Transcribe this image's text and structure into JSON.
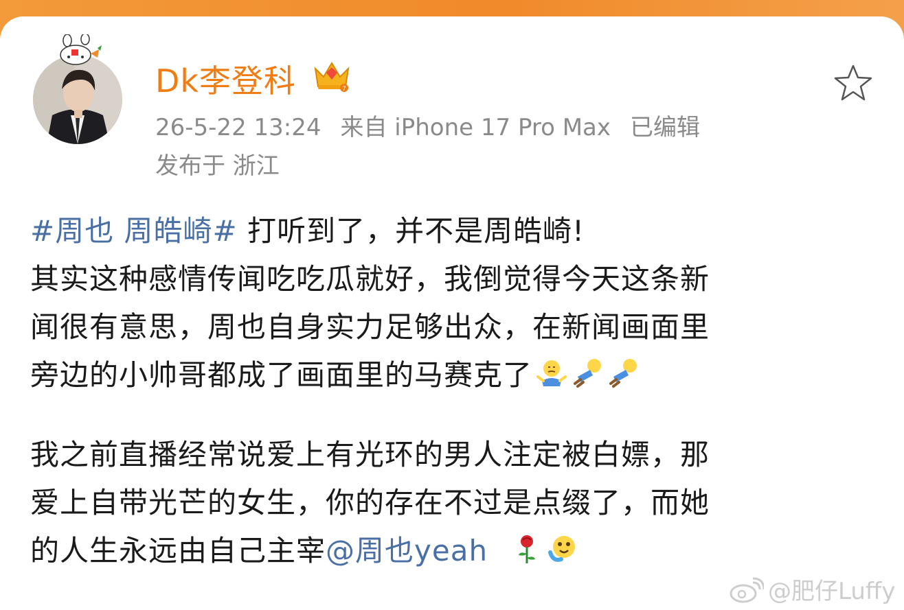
{
  "post": {
    "author": "Dk李登科",
    "timestamp": "26-5-22 13:24",
    "source": "来自 iPhone 17 Pro Max",
    "edited": "已编辑",
    "location": "发布于 浙江",
    "hashtag": "#周也 周皓崎#",
    "lines": {
      "l1": "打听到了，并不是周皓崎!",
      "l2": "其实这种感情传闻吃吃瓜就好，我倒觉得今天这条新",
      "l3": "闻很有意思，周也自身实力足够出众，在新闻画面里",
      "l4": "旁边的小帅哥都成了画面里的马赛克了",
      "l5": "我之前直播经常说爱上有光环的男人注定被白嫖，那",
      "l6": "爱上自带光芒的女生，你的存在不过是点缀了，而她",
      "l7": "的人生永远由自己主宰"
    },
    "mention": "@周也yeah"
  },
  "icons": {
    "star": "star-outline-icon",
    "crown": "crown-vip-icon",
    "emojis": [
      "shrug-emoji",
      "lying-flat-emoji",
      "lying-flat-emoji",
      "rose-emoji",
      "hug-emoji"
    ]
  },
  "watermark": "@肥仔Luffy",
  "colors": {
    "accent": "#f07c14",
    "link": "#4a6fa5",
    "meta": "#8a8a8a",
    "header": "#f39a3a"
  }
}
